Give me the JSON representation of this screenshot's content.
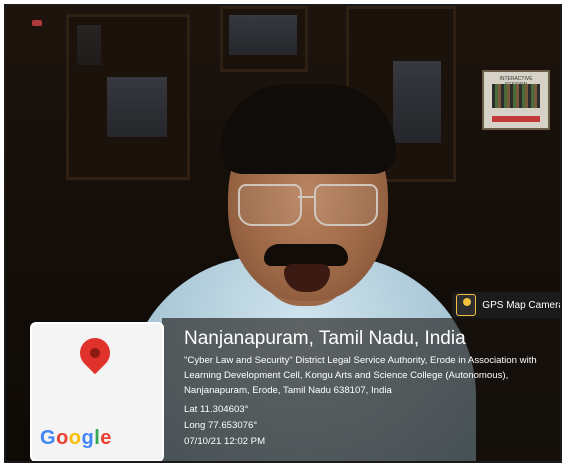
{
  "overlay": {
    "app_badge": "GPS Map Camera",
    "location_title": "Nanjanapuram, Tamil Nadu, India",
    "address": "\"Cyber Law and Security\" District Legal Service Authority, Erode in Association with Learning Development Cell, Kongu Arts and Science College (Autonomous), Nanjanapuram, Erode, Tamil Nadu 638107, India",
    "lat": "Lat 11.304603°",
    "long": "Long 77.653076°",
    "datetime": "07/10/21 12:02 PM",
    "map_logo": [
      "G",
      "o",
      "o",
      "g",
      "l",
      "e"
    ],
    "logo_colors": [
      "#4285F4",
      "#EA4335",
      "#FBBC05",
      "#4285F4",
      "#34A853",
      "#EA4335"
    ]
  },
  "background": {
    "poster_title": "INTERACTIVE SESSION"
  }
}
